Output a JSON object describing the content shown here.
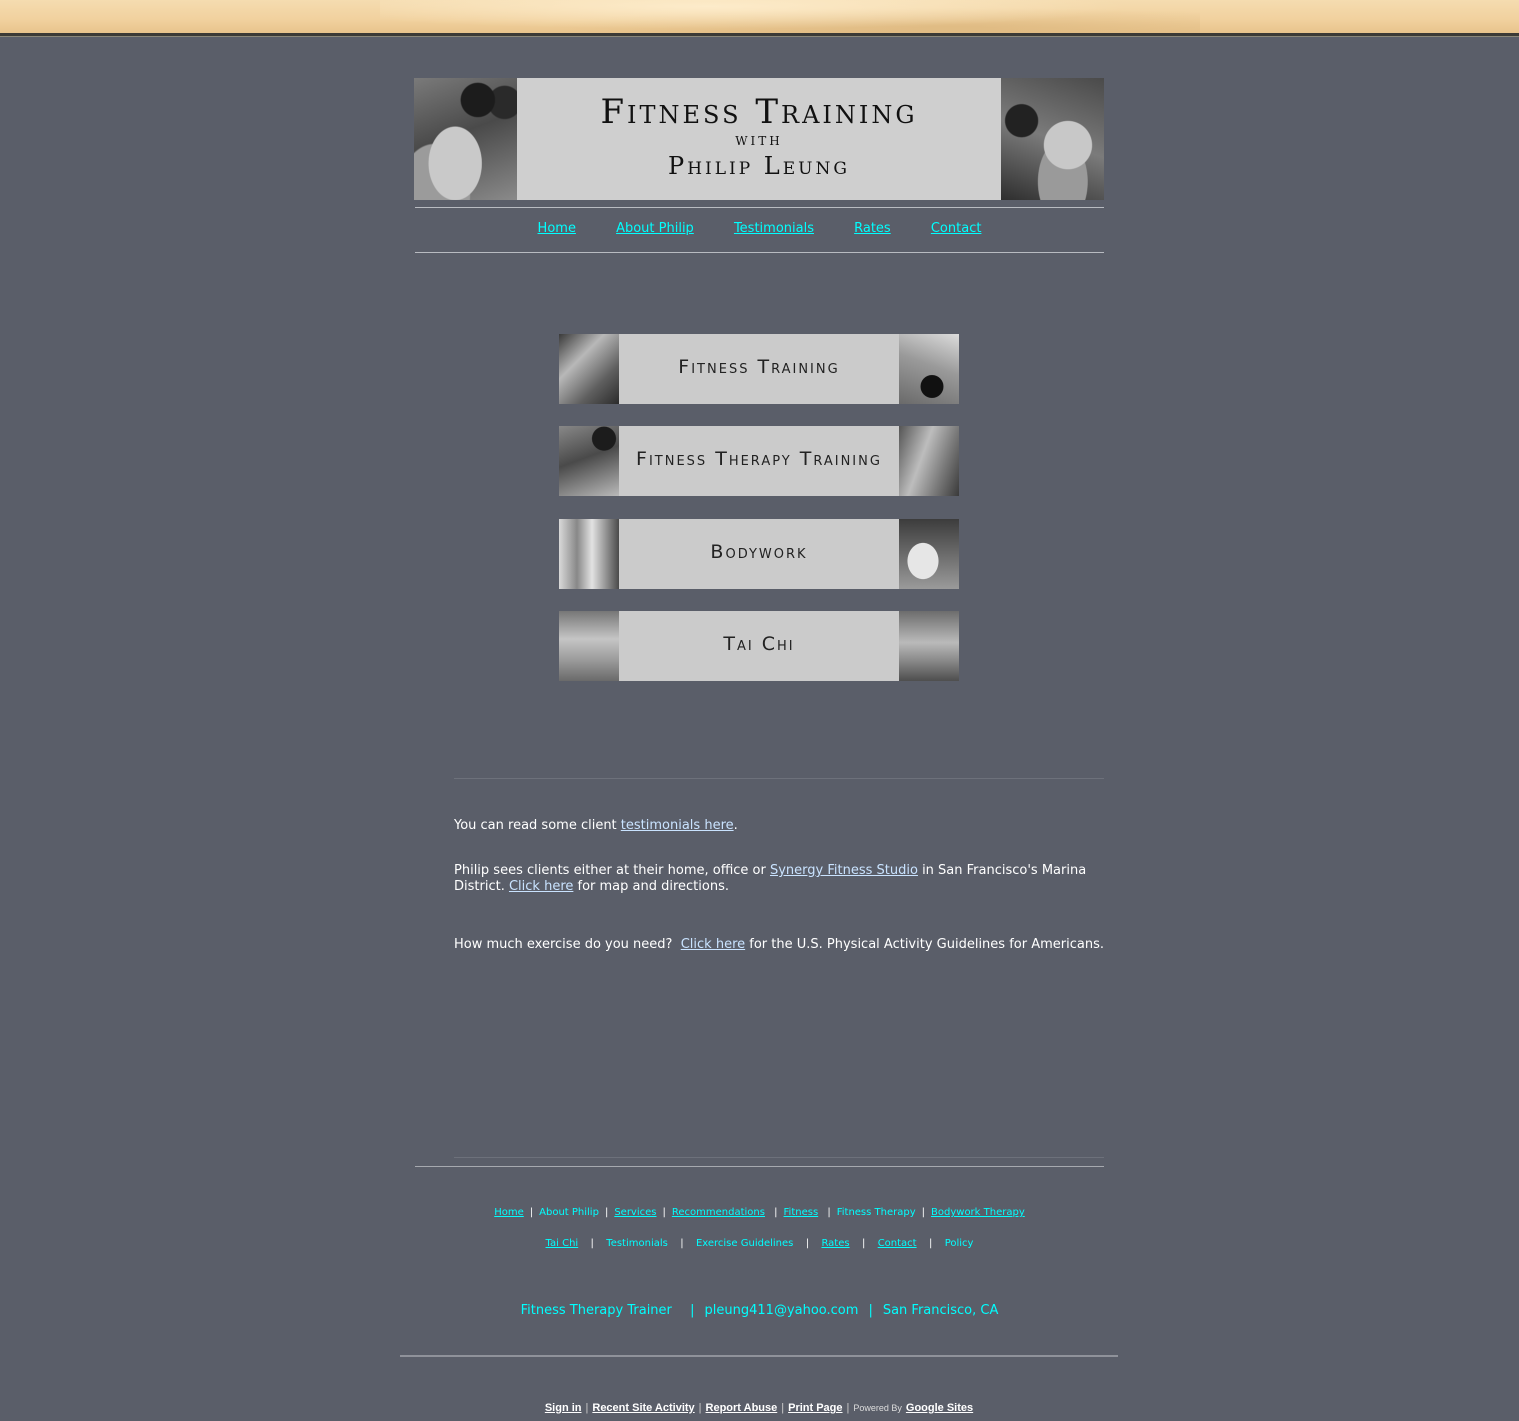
{
  "header": {
    "title": "Fitness Training",
    "with": "WITH",
    "name": "Philip Leung"
  },
  "nav": {
    "items": [
      "Home",
      "About Philip",
      "Testimonials",
      "Rates",
      "Contact"
    ]
  },
  "services": [
    {
      "label": "Fitness Training"
    },
    {
      "label": "Fitness Therapy Training"
    },
    {
      "label": "Bodywork"
    },
    {
      "label": "Tai Chi"
    }
  ],
  "content": {
    "p1_before": "You can read some client ",
    "p1_link": "testimonials here",
    "p1_after": ".",
    "p2_before": "Philip sees clients either at their home, office or ",
    "p2_link1": "Synergy Fitness Studio",
    "p2_middle": " in San Francisco's Marina District. ",
    "p2_link2": "Click here",
    "p2_after": " for map and directions.",
    "p3_before": "How much exercise do you need?  ",
    "p3_link": "Click here",
    "p3_after": " for the U.S. Physical Activity Guidelines for Americans."
  },
  "footer": {
    "row1": [
      "Home",
      "About Philip",
      "Services",
      "Recommendations",
      "Fitness",
      "Fitness Therapy",
      "Bodywork Therapy"
    ],
    "row2": [
      "Tai Chi",
      "Testimonials",
      "Exercise Guidelines",
      "Rates",
      "Contact",
      "Policy"
    ],
    "contact": {
      "role": "Fitness Therapy Trainer",
      "email": "pleung411@yahoo.com",
      "location": "San Francisco, CA"
    }
  },
  "google_sites_bar": {
    "sign_in": "Sign in",
    "recent": "Recent Site Activity",
    "report": "Report Abuse",
    "print": "Print Page",
    "powered_by": "Powered By",
    "brand": "Google Sites"
  }
}
